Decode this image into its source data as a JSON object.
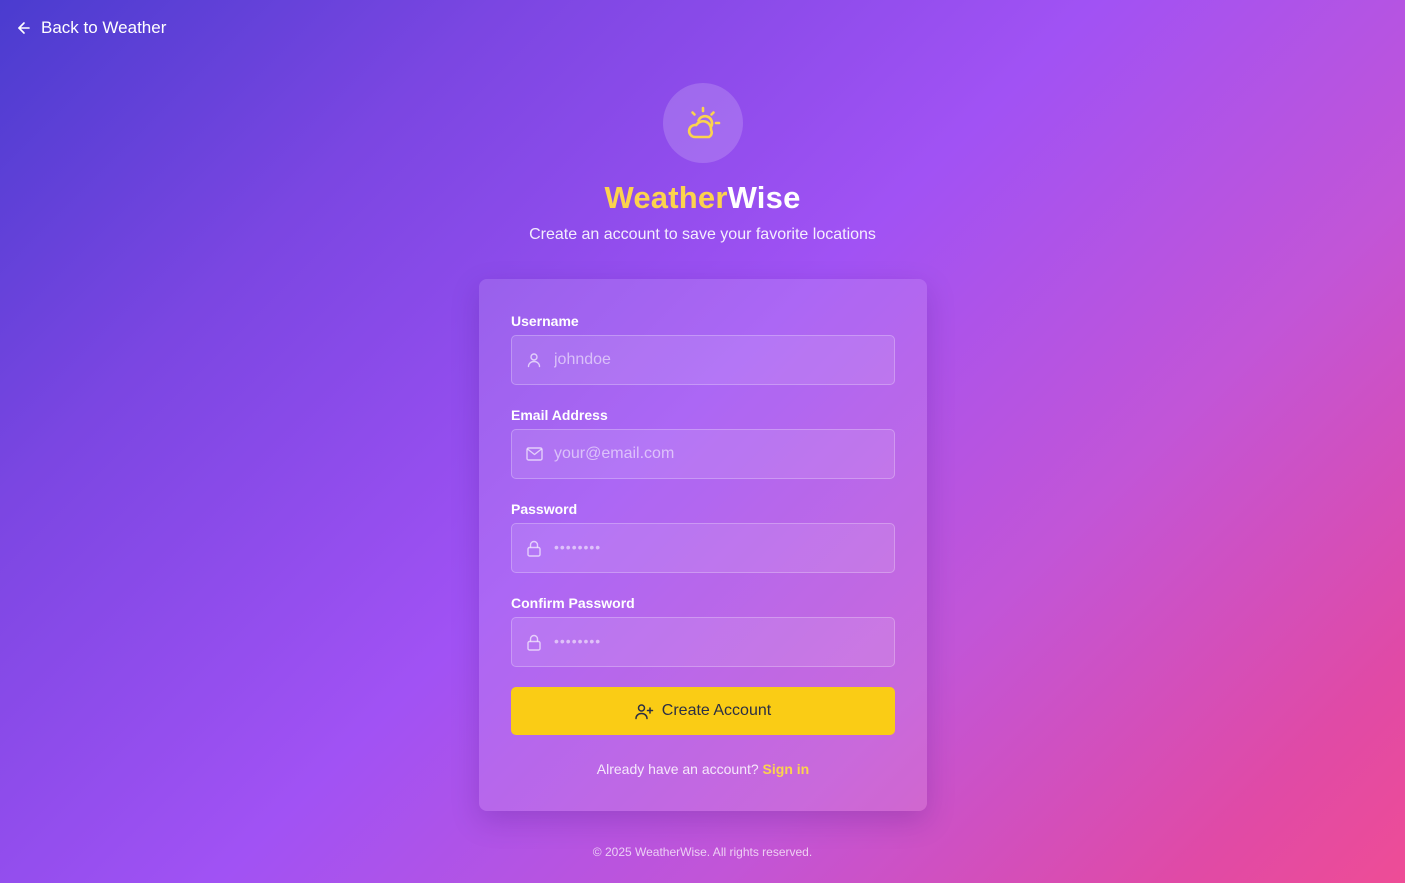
{
  "nav": {
    "back_label": "Back to Weather",
    "back_icon": "arrow-left-icon"
  },
  "brand": {
    "icon": "sun-cloud-icon",
    "name_part1": "Weather",
    "name_part2": "Wise",
    "subtitle": "Create an account to save your favorite locations",
    "accent_color": "#fcd34d"
  },
  "form": {
    "username": {
      "label": "Username",
      "placeholder": "johndoe",
      "value": "",
      "icon": "user-icon"
    },
    "email": {
      "label": "Email Address",
      "placeholder": "your@email.com",
      "value": "",
      "icon": "mail-icon"
    },
    "password": {
      "label": "Password",
      "placeholder": "••••••••",
      "value": "",
      "icon": "lock-icon"
    },
    "confirm_password": {
      "label": "Confirm Password",
      "placeholder": "••••••••",
      "value": "",
      "icon": "lock-icon"
    },
    "submit": {
      "label": "Create Account",
      "icon": "user-plus-icon",
      "color": "#facc15"
    },
    "signin_prompt": "Already have an account?",
    "signin_link": "Sign in"
  },
  "footer": {
    "text": "© 2025 WeatherWise. All rights reserved."
  },
  "colors": {
    "gradient": [
      "#4a3ccf",
      "#a152f4",
      "#ee4c96"
    ],
    "button": "#facc15",
    "button_text": "#2b2f45"
  }
}
